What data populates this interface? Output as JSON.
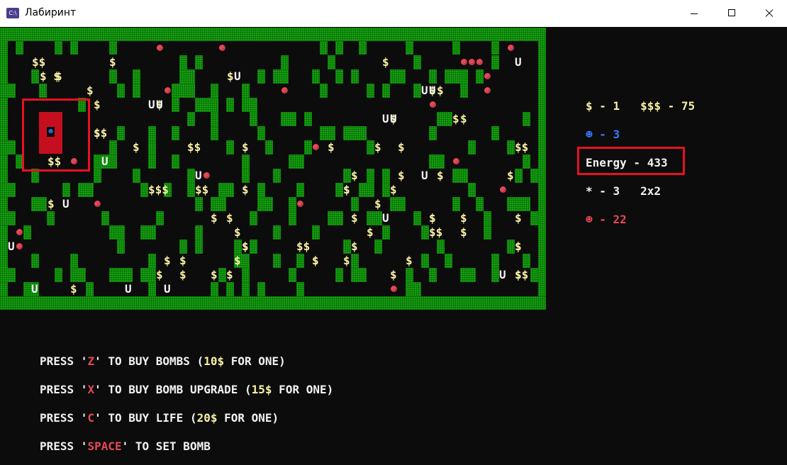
{
  "window": {
    "title": "Лабиринт",
    "icon": "console-app-icon"
  },
  "colors": {
    "wall": "#13a10e",
    "coin": "#f9f1a5",
    "enemy": "#e74856",
    "player": "#3b78ff",
    "highlight": "#e81123"
  },
  "maze": {
    "coins": [
      "$$",
      "$",
      "$ $",
      "$",
      "$",
      "$",
      "$$",
      "$",
      "$$",
      "$",
      "$",
      "$",
      "$",
      "$$",
      "$$",
      "$",
      "$",
      "$",
      "$",
      "$$$",
      "$$",
      "$",
      "$",
      "$",
      "$",
      "$",
      "$",
      "$",
      "$",
      "$",
      "$",
      "$",
      "$",
      "$$",
      "$",
      "$",
      "$$",
      "$",
      "$",
      "$",
      "$",
      "$",
      "$",
      "$",
      "$",
      "$",
      "$",
      "$",
      "$",
      "$",
      "$$",
      "$",
      "$",
      "$",
      "$",
      "$",
      "$",
      "$",
      "$",
      "$",
      "$",
      "$",
      "$",
      "$",
      "$",
      "$",
      "$",
      "$"
    ],
    "upgrades": [
      "U",
      "U",
      "U",
      "U",
      "U",
      "U",
      "U",
      "U",
      "U",
      "U",
      "U",
      "U",
      "U",
      "U",
      "U",
      "U",
      "U",
      "U"
    ],
    "enemy_count_shown": 22,
    "player_glyph": "☻"
  },
  "stats": {
    "coins": "$ - 1   $$$ - 75",
    "lives": "☻ - 3",
    "energy": "Energy - 433",
    "bombs": "* - 3   2x2",
    "enemies": "☻ - 22"
  },
  "help": [
    {
      "pre": "PRESS '",
      "key": "Z",
      "mid": "' TO BUY BOMBS (",
      "num": "10$",
      "post": " FOR ONE)"
    },
    {
      "pre": "PRESS '",
      "key": "X",
      "mid": "' TO BUY BOMB UPGRADE (",
      "num": "15$",
      "post": " FOR ONE)"
    },
    {
      "pre": "PRESS '",
      "key": "C",
      "mid": "' TO BUY LIFE (",
      "num": "20$",
      "post": " FOR ONE)"
    },
    {
      "pre": "PRESS '",
      "key": "SPACE",
      "mid": "' TO SET BOMB",
      "num": "",
      "post": ""
    }
  ]
}
